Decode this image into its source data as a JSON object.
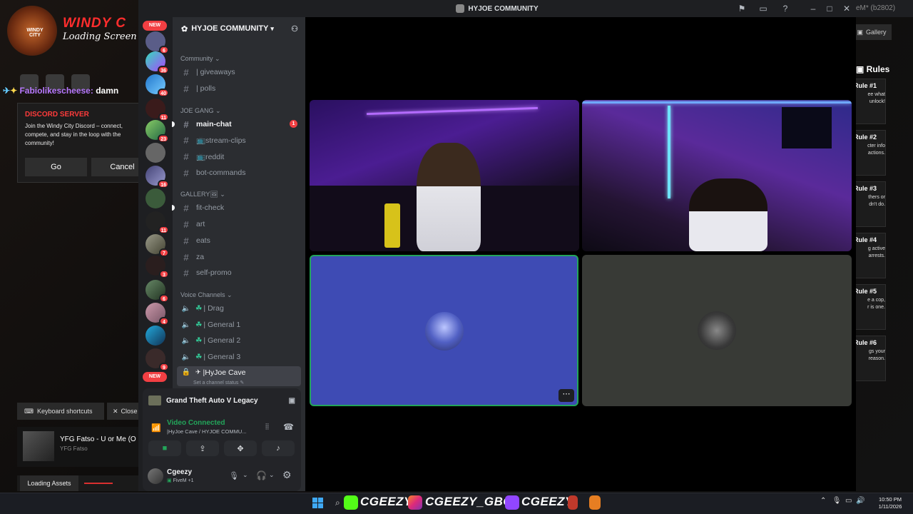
{
  "overlay": {
    "brand_windy": "WINDY C",
    "brand_loading": "Loading Screen",
    "logo_text": "WINDY CITY",
    "chat_user": "Fabiolikescheese:",
    "chat_msg": "damn",
    "discord_card": {
      "title": "DISCORD SERVER",
      "body": "Join the Windy City Discord – connect, compete, and stay in the loop with the community!",
      "go_label": "Go",
      "cancel_label": "Cancel"
    },
    "keyboard_shortcuts": "Keyboard shortcuts",
    "close_label": "Close",
    "song_title": "YFG Fatso - U or Me (O",
    "song_artist": "YFG Fatso",
    "loading_assets": "Loading Assets",
    "gallery_label": "Gallery",
    "rules_title": "Rules",
    "rules": [
      {
        "title": "Rule #1",
        "desc": "ee what\nunlock!"
      },
      {
        "title": "Rule #2",
        "desc": "cter info\nactions."
      },
      {
        "title": "Rule #3",
        "desc": "thers or\ndn't do."
      },
      {
        "title": "Rule #4",
        "desc": "g active\narrests."
      },
      {
        "title": "Rule #5",
        "desc": "e a cop,\nr is one."
      },
      {
        "title": "Rule #6",
        "desc": "gs your\nreason."
      }
    ]
  },
  "window": {
    "title": "HYJOE COMMUNITY",
    "title_suffix": "eM* (b2802)"
  },
  "server_list": {
    "new_label": "NEW",
    "badges": [
      "6",
      "36",
      "40",
      "11",
      "23",
      "16",
      "11",
      "7",
      "3",
      "6",
      "4",
      "9"
    ]
  },
  "guild": {
    "name": "HYJOE COMMUNITY",
    "categories": {
      "community": "Community",
      "joe_gang": "JOE GANG",
      "gallery": "GALLERY🖼",
      "voice": "Voice Channels"
    },
    "channels": {
      "giveaways": "| giveaways",
      "polls": "| polls",
      "main_chat": "main-chat",
      "stream_clips": "📺stream-clips",
      "reddit": "📺reddit",
      "bot_commands": "bot-commands",
      "fit_check": "fit-check",
      "art": "art",
      "eats": "eats",
      "za": "za",
      "self_promo": "self-promo",
      "drag": "| Drag",
      "general1": "| General 1",
      "general2": "| General 2",
      "general3": "| General 3",
      "hyjoe_cave": "|HyJoe Cave"
    },
    "main_chat_mentions": "1",
    "set_status": "Set a channel status"
  },
  "panel": {
    "game": "Grand Theft Auto V Legacy",
    "voice_status": "Video Connected",
    "voice_channel": "|HyJoe Cave / HYJOE COMMU...",
    "username": "Cgeezy",
    "user_status": "FiveM +1"
  },
  "taskbar": {
    "brand1": "CGEEZY",
    "brand2": "CGEEZY_GBC",
    "brand3": "CGEEZY",
    "time": "10:50 PM",
    "date": "1/11/2026"
  },
  "colors": {
    "accent_green": "#23a55a",
    "mention_red": "#f23f43",
    "tile_blue": "#3e4bb4",
    "kick_green": "#53fc18",
    "instagram_pink": "#e1306c",
    "twitch_purple": "#9146ff"
  }
}
